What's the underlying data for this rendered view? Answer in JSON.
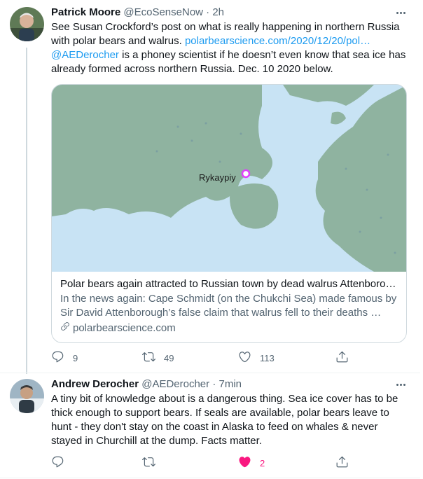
{
  "tweets": [
    {
      "name": "Patrick Moore",
      "handle": "@EcoSenseNow",
      "separator": "·",
      "time": "2h",
      "text_intro": "See Susan Crockford’s post on what is really happening in northern Russia with polar bears and walrus. ",
      "text_link": "polarbearscience.com/2020/12/20/pol…",
      "text_mention": "@AEDerocher",
      "text_rest": " is a phoney scientist if he doesn’t even know that sea ice has already formed across northern Russia. Dec. 10 2020 below.",
      "card": {
        "map_label": "Rykaypiy",
        "title": "Polar bears again attracted to Russian town by dead walrus Attenborou…",
        "description": "In the news again: Cape Schmidt (on the Chukchi Sea) made famous by Sir David Attenborough’s false claim that walrus fell to their deaths …",
        "domain": "polarbearscience.com"
      },
      "actions": {
        "replies": "9",
        "retweets": "49",
        "likes": "113"
      }
    },
    {
      "name": "Andrew Derocher",
      "handle": "@AEDerocher",
      "separator": "·",
      "time": "7min",
      "text": "A tiny bit of knowledge about is a dangerous thing. Sea ice cover has to be thick enough to support bears. If seals are available, polar bears leave to hunt - they don't stay on the coast in Alaska to feed on whales & never stayed in Churchill at the dump. Facts matter.",
      "actions": {
        "replies": "",
        "retweets": "",
        "likes": "2"
      }
    }
  ],
  "colors": {
    "text": "#0f1419",
    "secondary": "#536471",
    "link": "#1d9bf0",
    "like": "#f91880",
    "map_water": "#c8e3f4",
    "map_land": "#8fb3a0"
  },
  "icons": [
    "reply-icon",
    "retweet-icon",
    "like-icon",
    "share-icon",
    "more-icon",
    "link-icon",
    "map-pin-icon"
  ]
}
